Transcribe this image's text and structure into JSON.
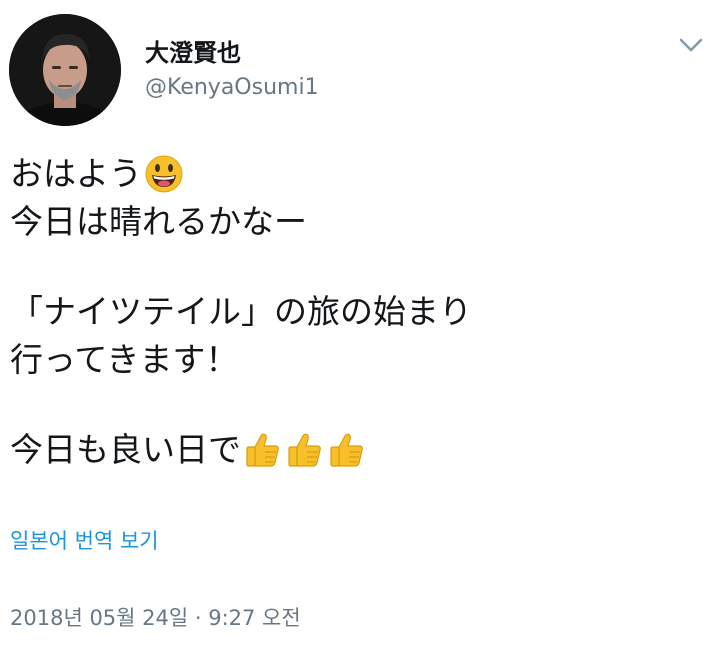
{
  "author": {
    "display_name": "大澄賢也",
    "handle": "@KenyaOsumi1",
    "avatar_icon": "profile-photo"
  },
  "menu": {
    "caret_icon": "chevron-down-icon"
  },
  "tweet": {
    "lines": [
      "おはよう",
      "今日は晴れるかなー",
      "",
      "「ナイツテイル」の旅の始まり",
      "行ってきます！",
      "",
      "今日も良い日で"
    ],
    "emojis": {
      "smiley": "grinning-face-emoji",
      "thumbs": [
        "thumbs-up-emoji",
        "thumbs-up-emoji",
        "thumbs-up-emoji"
      ]
    }
  },
  "translate_label": "일본어 번역 보기",
  "timestamp": "2018년 05월 24일 · 9:27 오전",
  "colors": {
    "text": "#14171a",
    "secondary": "#657786",
    "link": "#1b95e0",
    "emoji_yellow": "#f7c02b"
  }
}
